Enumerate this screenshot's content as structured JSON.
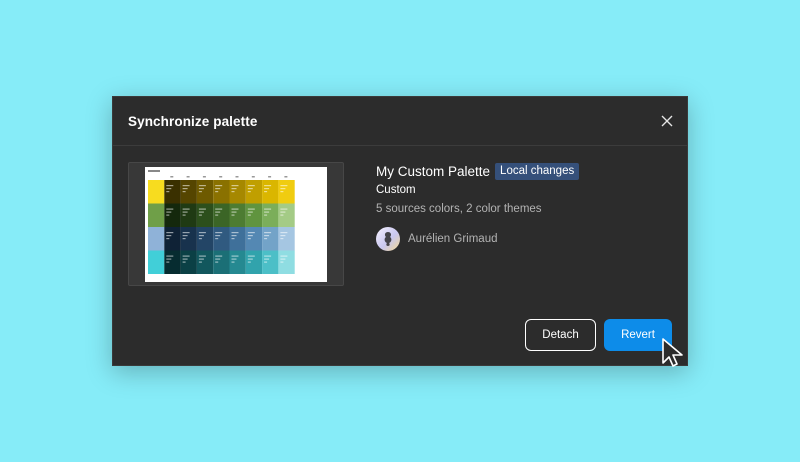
{
  "dialog": {
    "title": "Synchronize palette",
    "close_icon": "close-icon"
  },
  "palette": {
    "name": "My Custom Palette",
    "badge": "Local changes",
    "subtitle": "Custom",
    "details": "5 sources colors, 2 color themes",
    "author": "Aurélien Grimaud",
    "thumbnail_rows": [
      {
        "base": "#f7dc1f",
        "shades": [
          "#3a3000",
          "#554500",
          "#6e5a00",
          "#8a7100",
          "#a68800",
          "#c09f00",
          "#dab600",
          "#f0cc10"
        ]
      },
      {
        "base": "#6f9f48",
        "shades": [
          "#14280c",
          "#1f3a13",
          "#2c4f1c",
          "#3b6526",
          "#4d7c32",
          "#60943f",
          "#7bae5a",
          "#a4cb86"
        ]
      },
      {
        "base": "#8fb2d8",
        "shades": [
          "#0f2236",
          "#18324d",
          "#234566",
          "#305a80",
          "#3f709a",
          "#5488b3",
          "#73a3c8",
          "#a5c6e2"
        ]
      },
      {
        "base": "#41cfd8",
        "shades": [
          "#062c30",
          "#0b4045",
          "#12575d",
          "#1b6f76",
          "#258991",
          "#31a3ac",
          "#4cbfc7",
          "#8fdde2"
        ]
      }
    ]
  },
  "actions": {
    "detach_label": "Detach",
    "revert_label": "Revert"
  },
  "colors": {
    "background": "#86ecf8",
    "dialog": "#2c2c2c",
    "primary": "#0d8ce9",
    "badge": "#35507a"
  }
}
